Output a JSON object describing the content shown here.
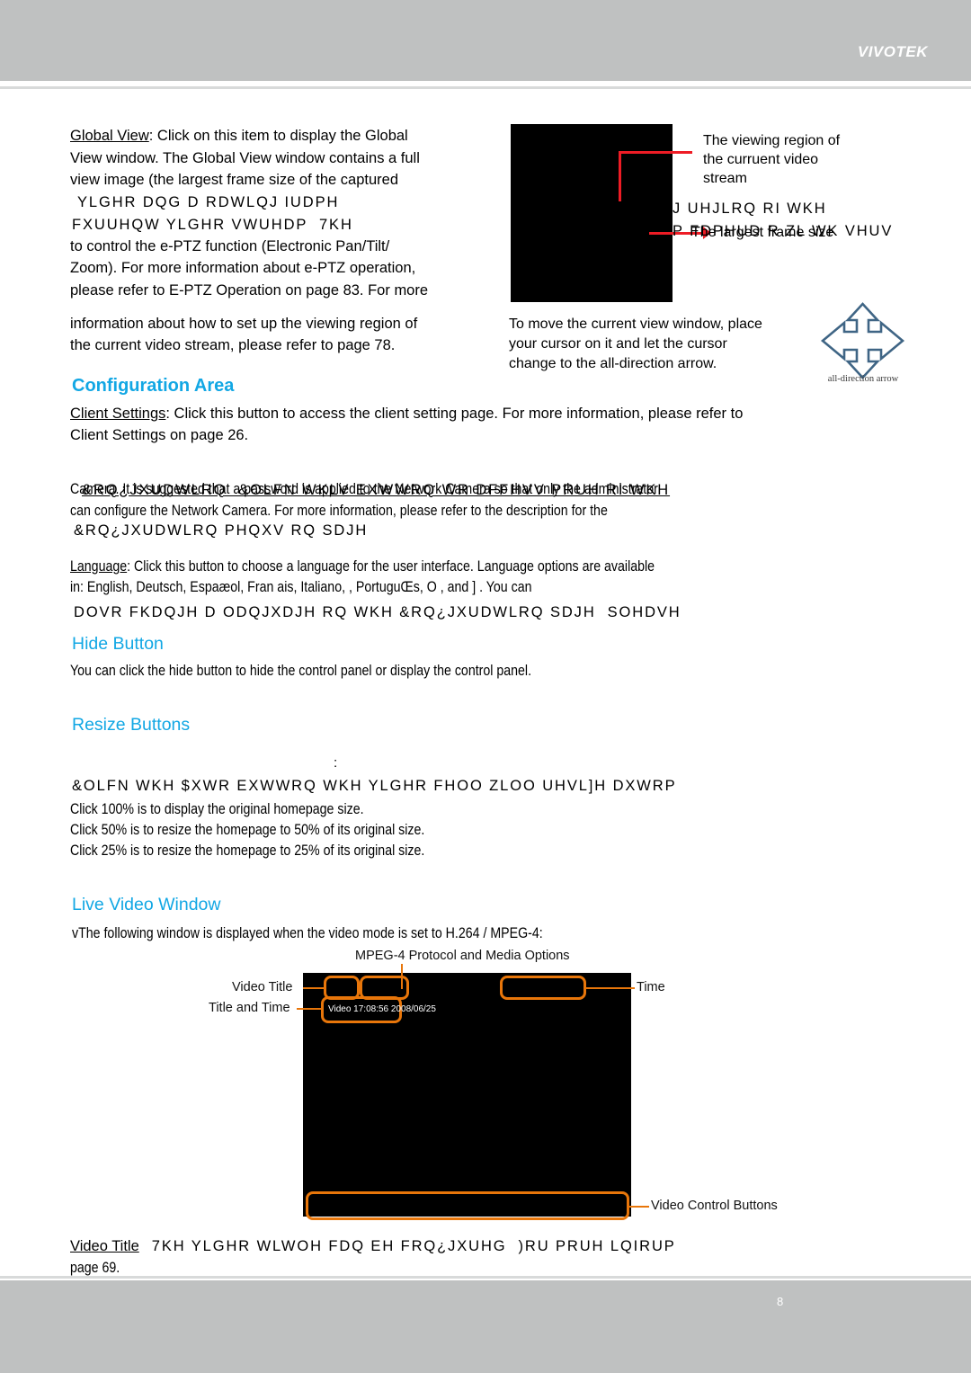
{
  "header": {
    "brand": "VIVOTEK"
  },
  "footer": {
    "page_glyph": "8"
  },
  "global_view": {
    "paragraph_lines": [
      "Global View",
      ": Click on this item to display the Global",
      "View window. The Global View window contains a full",
      "view image (the largest frame size of the captured",
      "YLGHR DQG D RDWLQJ IUDPH",
      "FXUUHQW YLGHR VWUHDP  7KH",
      "to control the e-PTZ function (Electronic Pan/Tilt/",
      "Zoom). For more information about e-PTZ operation,",
      "please refer to E-PTZ Operation on page 83. For more",
      "information about how to set up the viewing region of",
      "the current video stream, please refer to page 78."
    ],
    "callout_region": [
      "The viewing region of",
      "the curruent video",
      "stream"
    ],
    "callout_garble_line1": "J UHJLRQ RI WKH",
    "callout_garble_line2": "P FDPHUD R ZL WK VHUV",
    "callout_overlay": "The largest frame size",
    "move_note": [
      "To move the current view window, place",
      "your cursor on it and let the cursor",
      "change to the all-direction arrow."
    ],
    "arrow_caption": "all-direction arrow"
  },
  "configuration_area": {
    "heading": "Configuration Area",
    "client_settings_label": "Client Settings",
    "client_settings_text": ": Click this button to access the client setting page. For more information, please refer to",
    "client_settings_line2": "Client Settings on page 26.",
    "config_garble_line1": "&RQ¿JXUDWLRQ  &OLFN WKLV EXWWRQ WR DFFHVV PRUH RI WKH",
    "config_line2": "Camera. It is suggested that a password is applied to the Network Camera so that only the administrator",
    "config_line3": "can configure the Network Camera. For more information, please refer to the description for the",
    "config_garble_line4": "&RQ¿JXUDWLRQ PHQXV RQ SDJH",
    "language_label": "Language",
    "language_line1": ": Click this button to choose a language for the user interface. Language options are available",
    "language_line2": "in: English, Deutsch, Espaæol, Fran ais, Italiano,          , PortuguŒs, O         , and   ]       . You can",
    "language_garble_line3": "DOVR FKDQJH D ODQJXDJH RQ WKH &RQ¿JXUDWLRQ SDJH  SOHDVH"
  },
  "hide_button": {
    "heading": "Hide Button",
    "text": "You can click the hide button to hide the control panel or display the control panel."
  },
  "resize_buttons": {
    "heading": "Resize Buttons",
    "stray_colon": ":",
    "garble_line": "&OLFN WKH $XWR EXWWRQ  WKH YLGHR FHOO ZLOO UHVL]H DXWRP",
    "line_100": "Click 100% is to display the original homepage size.",
    "line_50": "Click 50% is to resize the homepage to 50% of its original size.",
    "line_25": "Click 25% is to resize the homepage to 25% of its original size."
  },
  "live_video_window": {
    "heading": "Live Video Window",
    "intro": "vThe following window is displayed when the video mode is set to H.264 / MPEG-4:",
    "diagram": {
      "label_protocol": "MPEG-4 Protocol and Media Options",
      "label_video_title": "Video Title",
      "label_title_and_time": "Title and Time",
      "label_time": "Time",
      "label_video_control": "Video Control Buttons",
      "osd_text": "Video 17:08:56  2008/06/25"
    },
    "footer_label": "Video Title",
    "footer_garble": "7KH YLGHR WLWOH FDQ EH FRQ¿JXUHG  )RU PRUH LQIRUP",
    "footer_line2": "page 69."
  },
  "colors": {
    "header_gray": "#bfc1c1",
    "heading_blue": "#12a7e4",
    "callout_red": "#ee1c25",
    "diagram_orange": "#e8760a",
    "arrow_blue": "#3f6585"
  }
}
